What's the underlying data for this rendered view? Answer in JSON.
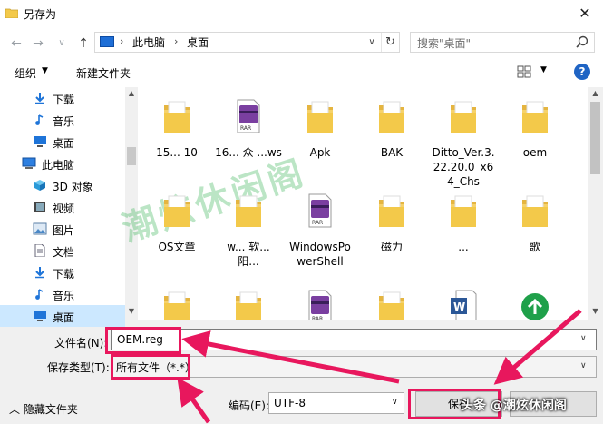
{
  "window": {
    "title": "另存为",
    "close_glyph": "✕"
  },
  "address": {
    "crumbs": [
      "此电脑",
      "桌面"
    ],
    "separator": "›",
    "dropdown_glyph": "∨",
    "refresh_glyph": "↻"
  },
  "nav_buttons": {
    "back": "←",
    "forward": "→",
    "recent": "∨",
    "up": "↑"
  },
  "search": {
    "placeholder": "搜索\"桌面\""
  },
  "toolbar": {
    "organize": "组织",
    "caret": "▼",
    "new_folder": "新建文件夹",
    "help": "?"
  },
  "sidebar": {
    "items": [
      {
        "label": "下载",
        "icon": "download-icon"
      },
      {
        "label": "音乐",
        "icon": "music-icon"
      },
      {
        "label": "桌面",
        "icon": "desktop-icon"
      },
      {
        "label": "此电脑",
        "icon": "computer-icon"
      },
      {
        "label": "3D 对象",
        "icon": "3d-objects-icon"
      },
      {
        "label": "视频",
        "icon": "video-icon"
      },
      {
        "label": "图片",
        "icon": "pictures-icon"
      },
      {
        "label": "文档",
        "icon": "documents-icon"
      },
      {
        "label": "下载",
        "icon": "download-icon"
      },
      {
        "label": "音乐",
        "icon": "music-icon"
      },
      {
        "label": "桌面",
        "icon": "desktop-icon",
        "selected": true
      }
    ]
  },
  "files": {
    "row1": [
      {
        "name": "15... 10",
        "icon": "folder-icon"
      },
      {
        "name": "16... 众 ...ws",
        "icon": "rar-archive-icon"
      },
      {
        "name": "Apk",
        "icon": "folder-icon"
      },
      {
        "name": "BAK",
        "icon": "folder-icon"
      },
      {
        "name": "Ditto_Ver.3.22.20.0_x64_Chs",
        "icon": "folder-icon"
      },
      {
        "name": "oem",
        "icon": "folder-icon"
      }
    ],
    "row2": [
      {
        "name": "OS文章",
        "icon": "folder-icon"
      },
      {
        "name": "w... 软... 阳...",
        "icon": "folder-icon"
      },
      {
        "name": "WindowsPowerShell",
        "icon": "rar-archive-icon"
      },
      {
        "name": "磁力",
        "icon": "folder-icon"
      },
      {
        "name": "...",
        "icon": "folder-icon"
      },
      {
        "name": "歌",
        "icon": "folder-icon"
      }
    ],
    "row3_icons": [
      "folder-icon",
      "folder-icon",
      "rar-archive-icon",
      "folder-icon",
      "word-document-icon",
      "app-icon"
    ]
  },
  "form": {
    "filename_label": "文件名(N):",
    "filename_value": "OEM.reg",
    "filetype_label": "保存类型(T):",
    "filetype_value": "所有文件（*.*）",
    "hide_folders": "隐藏文件夹",
    "encoding_label": "编码(E):",
    "encoding_value": "UTF-8",
    "save_label": "保存",
    "caret": "∨"
  },
  "overlay": {
    "watermark": "潮炫休闲阁",
    "brand": "头条 @潮炫休闲阁",
    "annotation_color": "#e8175d"
  },
  "colors": {
    "accent": "#1f64c4",
    "folder": "#f3c94a",
    "selection": "#cce8ff"
  }
}
